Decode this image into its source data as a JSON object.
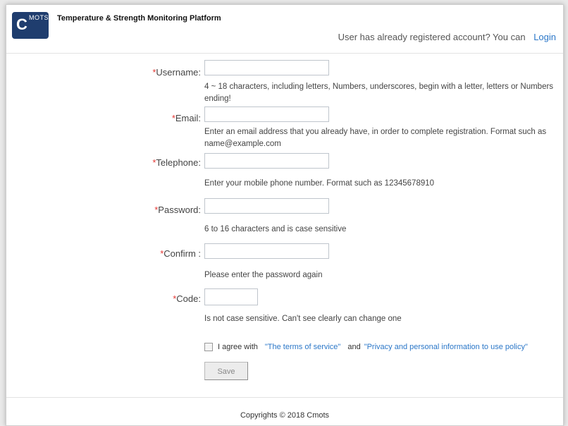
{
  "header": {
    "logo_big": "C",
    "logo_small": "MOTS",
    "title": "Temperature & Strength Monitoring Platform",
    "registered_text": "User has already registered account? You can",
    "login_link": "Login"
  },
  "form": {
    "required_mark": "*",
    "username": {
      "label": "Username:",
      "value": "",
      "hint": "4 ~ 18 characters, including letters, Numbers, underscores, begin with a letter, letters or Numbers ending!"
    },
    "email": {
      "label": "Email:",
      "value": "",
      "hint": "Enter an email address that you already have, in order to complete registration. Format such as name@example.com"
    },
    "telephone": {
      "label": "Telephone:",
      "value": "",
      "hint": "Enter your mobile phone number. Format such as 12345678910"
    },
    "password": {
      "label": "Password:",
      "value": "",
      "hint": "6 to 16 characters and is case sensitive"
    },
    "confirm": {
      "label": "Confirm :",
      "value": "",
      "hint": "Please enter the password again"
    },
    "code": {
      "label": "Code:",
      "value": "",
      "hint": "Is not case sensitive. Can't see clearly can change one"
    },
    "agreement": {
      "checked": false,
      "prefix": "I agree with",
      "terms_link": "\"The terms of service\"",
      "and": "and",
      "privacy_link": "\"Privacy and personal information to use policy\""
    },
    "save_label": "Save"
  },
  "footer": {
    "copyright": "Copyrights © 2018 Cmots"
  },
  "colors": {
    "brand": "#1f3d6e",
    "link": "#2b77c8",
    "required": "#e53935"
  }
}
